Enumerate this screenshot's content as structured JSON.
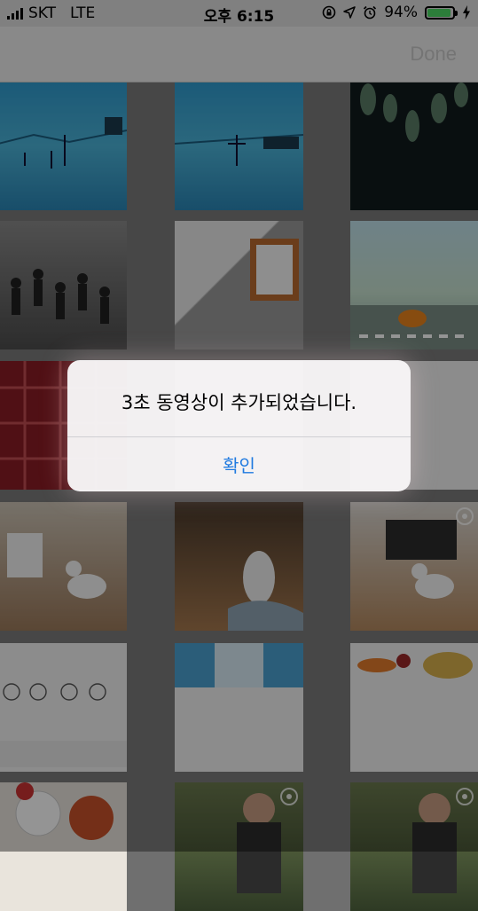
{
  "status_bar": {
    "carrier": "SKT",
    "network": "LTE",
    "time": "오후 6:15",
    "battery_percent": "94%",
    "battery_level": 0.94
  },
  "nav": {
    "done_label": "Done"
  },
  "alert": {
    "message": "3초 동영상이 추가되었습니다.",
    "confirm_label": "확인"
  },
  "colors": {
    "alert_button": "#1f7ae0",
    "battery_fill": "#4cd964"
  },
  "icons": [
    "signal-icon",
    "lock-rotation-icon",
    "location-arrow-icon",
    "alarm-icon",
    "battery-icon",
    "charging-icon",
    "live-photo-icon"
  ]
}
